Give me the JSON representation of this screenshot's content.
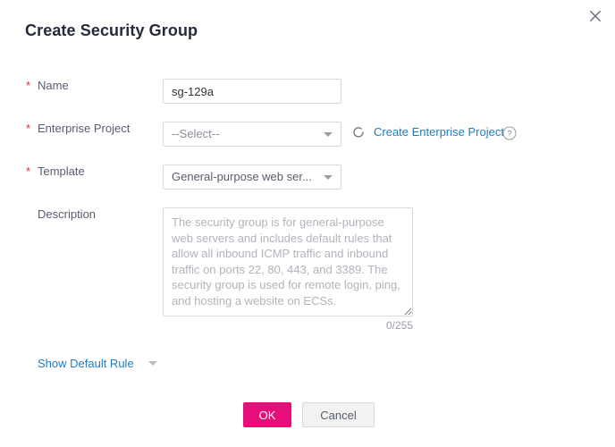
{
  "dialog": {
    "title": "Create Security Group",
    "close_icon": "close-icon"
  },
  "form": {
    "name": {
      "label": "Name",
      "required_marker": "*",
      "value": "sg-129a",
      "placeholder": ""
    },
    "enterprise_project": {
      "label": "Enterprise Project",
      "required_marker": "*",
      "selected": "--Select--",
      "refresh_icon": "refresh-icon",
      "create_link": "Create Enterprise Project",
      "help_icon": "help-icon"
    },
    "template": {
      "label": "Template",
      "required_marker": "*",
      "selected": "General-purpose web ser..."
    },
    "description": {
      "label": "Description",
      "value": "",
      "placeholder": "The security group is for general-purpose web servers and includes default rules that allow all inbound ICMP traffic and inbound traffic on ports 22, 80, 443, and 3389. The security group is used for remote login, ping, and hosting a website on ECSs.",
      "counter": "0/255"
    }
  },
  "show_default_rule": {
    "label": "Show Default Rule",
    "caret_icon": "chevron-down-icon"
  },
  "footer": {
    "ok_label": "OK",
    "cancel_label": "Cancel"
  },
  "colors": {
    "primary": "#e60e79",
    "link": "#1f7dbd",
    "required": "#e63022",
    "title_text": "#252b3a",
    "label_text": "#575d6c",
    "border": "#d9d9d9",
    "placeholder": "#b0b4bb"
  }
}
